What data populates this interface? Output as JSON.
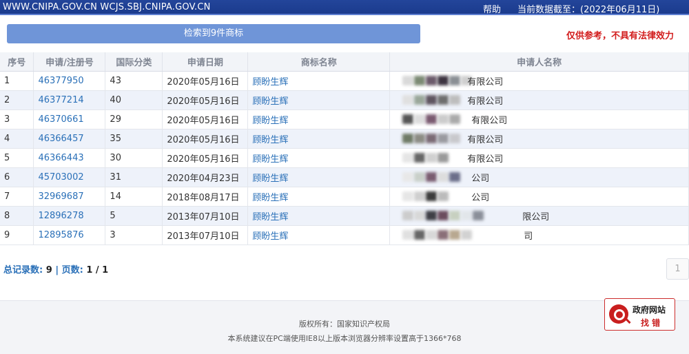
{
  "topbar": {
    "site": "WWW.CNIPA.GOV.CN WCJS.SBJ.CNIPA.GOV.CN",
    "help": "帮助",
    "date": "当前数据截至：(2022年06月11日)"
  },
  "summary": {
    "result_text": "检索到9件商标",
    "disclaimer": "仅供参考，不具有法律效力"
  },
  "table": {
    "headers": [
      "序号",
      "申请/注册号",
      "国际分类",
      "申请日期",
      "商标名称",
      "申请人名称"
    ],
    "rows": [
      {
        "idx": "1",
        "reg": "46377950",
        "cls": "43",
        "date": "2020年05月16日",
        "name": "顾盼生辉",
        "applicant_suffix": "有限公司"
      },
      {
        "idx": "2",
        "reg": "46377214",
        "cls": "40",
        "date": "2020年05月16日",
        "name": "顾盼生辉",
        "applicant_suffix": "有限公司"
      },
      {
        "idx": "3",
        "reg": "46370661",
        "cls": "29",
        "date": "2020年05月16日",
        "name": "顾盼生辉",
        "applicant_suffix": "有限公司"
      },
      {
        "idx": "4",
        "reg": "46366457",
        "cls": "35",
        "date": "2020年05月16日",
        "name": "顾盼生辉",
        "applicant_suffix": "有限公司"
      },
      {
        "idx": "5",
        "reg": "46366443",
        "cls": "30",
        "date": "2020年05月16日",
        "name": "顾盼生辉",
        "applicant_suffix": "有限公司"
      },
      {
        "idx": "6",
        "reg": "45703002",
        "cls": "31",
        "date": "2020年04月23日",
        "name": "顾盼生辉",
        "applicant_suffix": "公司"
      },
      {
        "idx": "7",
        "reg": "32969687",
        "cls": "14",
        "date": "2018年08月17日",
        "name": "顾盼生辉",
        "applicant_suffix": "公司"
      },
      {
        "idx": "8",
        "reg": "12896278",
        "cls": "5",
        "date": "2013年07月10日",
        "name": "顾盼生辉",
        "applicant_suffix": "限公司"
      },
      {
        "idx": "9",
        "reg": "12895876",
        "cls": "3",
        "date": "2013年07月10日",
        "name": "顾盼生辉",
        "applicant_suffix": "司"
      }
    ]
  },
  "pager": {
    "total_label": "总记录数:",
    "total": "9",
    "sep": "|",
    "pages_label": "页数:",
    "pages": "1 / 1",
    "page_button": "1"
  },
  "footer": {
    "copyright": "版权所有：国家知识产权局",
    "hint": "本系统建议在PC端使用IE8以上版本浏览器分辨率设置高于1366*768"
  },
  "gov_badge": {
    "line1": "政府网站",
    "line2": "找 错"
  },
  "colors": {
    "topbar": "#1a3a8c",
    "link": "#2a70b8",
    "disclaimer": "#d21c1c",
    "badge_red": "#c91f1f"
  }
}
